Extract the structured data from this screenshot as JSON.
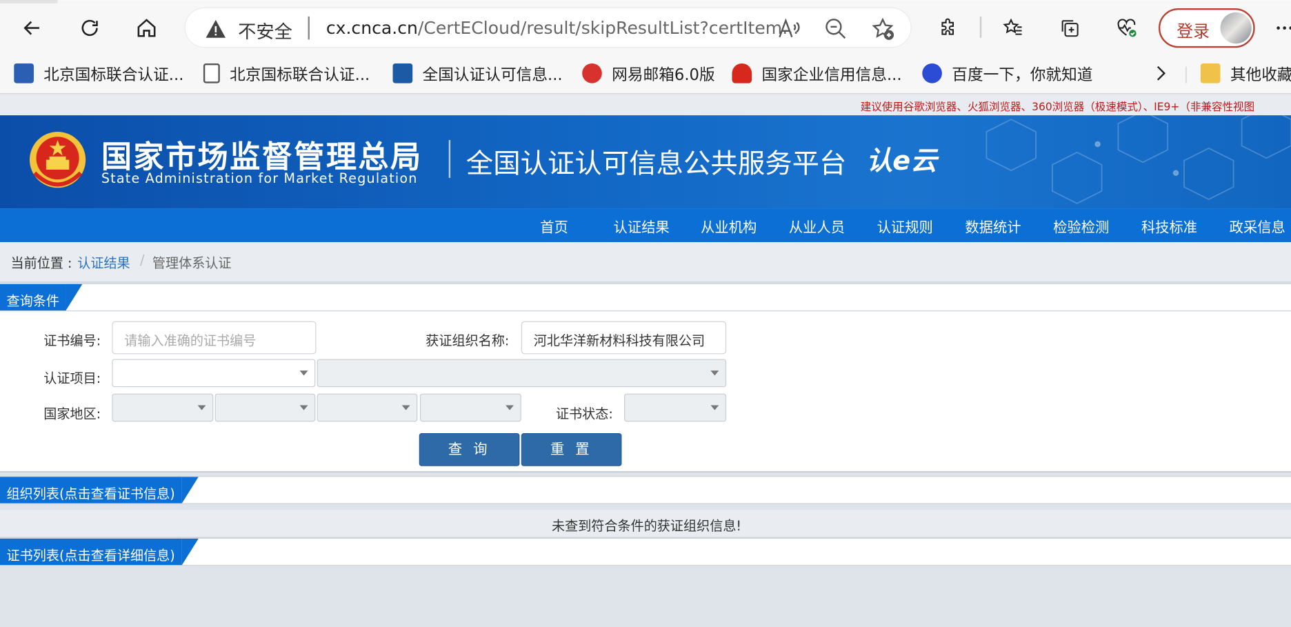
{
  "browser": {
    "insecure_label": "不安全",
    "url_main": "cx.cnca.cn",
    "url_path": "/CertECloud/result/skipResultList?certItem...",
    "login_label": "登录"
  },
  "bookmarks": [
    {
      "label": "北京国标联合认证...",
      "icon": "globe-icon",
      "color": "#2b5fb4"
    },
    {
      "label": "北京国标联合认证...",
      "icon": "page-icon",
      "color": "#555555"
    },
    {
      "label": "全国认证认可信息...",
      "icon": "cert-icon",
      "color": "#1d5aa6"
    },
    {
      "label": "网易邮箱6.0版",
      "icon": "mail-icon",
      "color": "#d8322f"
    },
    {
      "label": "国家企业信用信息...",
      "icon": "huawei-icon",
      "color": "#d7281d"
    },
    {
      "label": "百度一下，你就知道",
      "icon": "baidu-icon",
      "color": "#2d4cd6"
    },
    {
      "label": "其他收藏",
      "icon": "folder-icon",
      "color": "#f0c24a"
    }
  ],
  "notice": "建议使用谷歌浏览器、火狐浏览器、360浏览器（极速模式）、IE9+（非兼容性视图",
  "banner": {
    "agency_cn": "国家市场监督管理总局",
    "agency_en": "State Administration  for  Market Regulation",
    "platform": "全国认证认可信息公共服务平台",
    "logo": "认e云"
  },
  "nav": [
    "首页",
    "认证结果",
    "从业机构",
    "从业人员",
    "认证规则",
    "数据统计",
    "检验检测",
    "科技标准",
    "政采信息"
  ],
  "breadcrumb": {
    "prefix": "当前位置 :",
    "link": "认证结果",
    "separator": "/",
    "current": "管理体系认证"
  },
  "query": {
    "title": "查询条件",
    "cert_no_label": "证书编号:",
    "cert_no_placeholder": "请输入准确的证书编号",
    "org_label": "获证组织名称:",
    "org_value": "河北华洋新材料科技有限公司",
    "item_label": "认证项目:",
    "region_label": "国家地区:",
    "status_label": "证书状态:",
    "search_button": "查 询",
    "reset_button": "重 置"
  },
  "org_list": {
    "title": "组织列表(点击查看证书信息)",
    "empty": "未查到符合条件的获证组织信息!"
  },
  "cert_list": {
    "title": "证书列表(点击查看详细信息)"
  },
  "colors": {
    "brand_blue": "#0c6fd6",
    "button_blue": "#2f6aa8",
    "notice_red": "#c01818"
  }
}
